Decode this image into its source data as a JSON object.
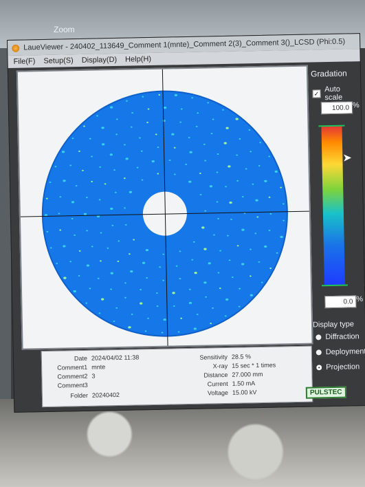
{
  "background": {
    "zoom_label": "Zoom"
  },
  "window": {
    "title": "LaueViewer - 240402_113649_Comment 1(mnte)_Comment 2(3)_Comment 3()_LCSD (Phi:0.5)",
    "menu": [
      "File(F)",
      "Setup(S)",
      "Display(D)",
      "Help(H)"
    ]
  },
  "gradation": {
    "title": "Gradation",
    "auto_scale_label": "Auto scale",
    "auto_scale_checked": true,
    "max_value": "100.0",
    "min_value": "0.0",
    "percent_unit": "%"
  },
  "display_type": {
    "title": "Display type",
    "options": [
      "Diffraction",
      "Deployment",
      "Projection"
    ],
    "selected": "Projection"
  },
  "info": {
    "date_label": "Date",
    "date_value": "2024/04/02 11:38",
    "comment1_label": "Comment1",
    "comment1_value": "mnte",
    "comment2_label": "Comment2",
    "comment2_value": "3",
    "comment3_label": "Comment3",
    "comment3_value": "",
    "folder_label": "Folder",
    "folder_value": "20240402",
    "sensitivity_label": "Sensitivity",
    "sensitivity_value": "28.5 %",
    "xray_label": "X-ray",
    "xray_value": "15 sec * 1 times",
    "distance_label": "Distance",
    "distance_value": "27.000 mm",
    "current_label": "Current",
    "current_value": "1.50 mA",
    "voltage_label": "Voltage",
    "voltage_value": "15.00 kV"
  },
  "brand": "PULSTEC",
  "colors": {
    "pattern_blue": "#1677e8",
    "marker_green": "#21c25a"
  }
}
